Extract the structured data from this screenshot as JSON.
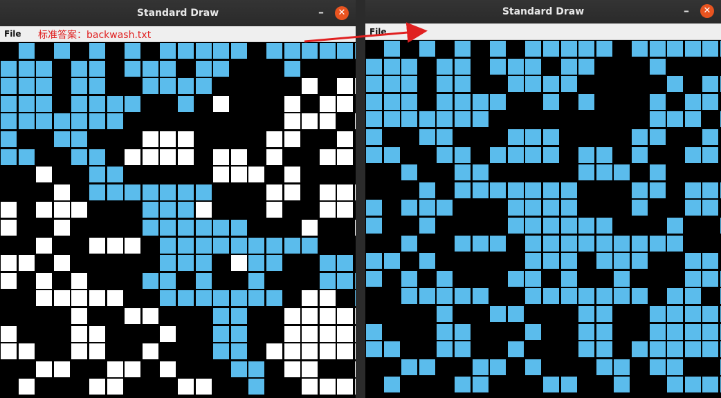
{
  "colors": {
    "blue": "#5bbcec",
    "white": "#ffffff",
    "black": "#000000",
    "annotation": "#e02020"
  },
  "left_window": {
    "title": "Standard Draw",
    "menu_file": "File",
    "annotation": "标准答案：backwash.txt",
    "grid": [
      ".B.B.B.B.BBBBB.BBBBBB",
      "BBB.BB.BBB.BB...B....",
      "BBB.BB..BBBB.....W.WW",
      "BBB.BBBB..B.W...W.WW.",
      "BBBBBBB.........WWW.W",
      "B..BB...WWW....WW..W.",
      "BB..BB.WWWW.WW.W..WW.",
      "..W..BB.....WWW.W....",
      "...W.BBBBBBB...WW.WWW",
      "W.WWW...BBBW...W..WW.",
      "W..W....BBBBBB...W..W",
      "..W..WWW.BBBBBBBBB...",
      "WW.W.....BBB.WBB..BB.",
      "W.W.W...BB.B..B...BBB",
      "..WWWWW..BBBBBBB.WW.B",
      "....W..WW...BB..WWWWW",
      "W...WW...W..BB..WWWWW",
      "WW..WW..W...BB.WWWWWW",
      "..WW..WW.W...BB.WW..W",
      ".W...WW...WW..B..WWWW"
    ]
  },
  "right_window": {
    "title": "Standard Draw",
    "menu_file": "File",
    "grid": [
      ".B.B.B.B.BBBBB.BBBBBB",
      "BBB.BB.BBB.BB...B....",
      "BBB.BB..BBBB.....B.BB",
      "BBB.BBBB..B.B...B.BB.",
      "BBBBBBB.........BBB.B",
      "B..BB...BBB....BB..B.",
      "BB..BB.BBBB.BB.B..BB.",
      "..B..BB.....BBB.B....",
      "...B.BBBBBBB...BB.BBB",
      "B.BBB...BBBB...B..BB.",
      "B..B....BBBBBB...B..B",
      "..B..BBB.BBBBBBBBB...",
      "BB.B.....BBB.BBB..BB.",
      "B.B.B...BB.B..B...BBB",
      "..BBBBB..BBBBBBB.BB.B",
      "....B..BB...BB..BBBBB",
      "B...BB...B..BB..BBBBB",
      "BB..BB..B...BB.BBBBBB",
      "..BB..BB.B...BB.BB..B",
      ".B...BB...BB..B..BBBB"
    ]
  }
}
